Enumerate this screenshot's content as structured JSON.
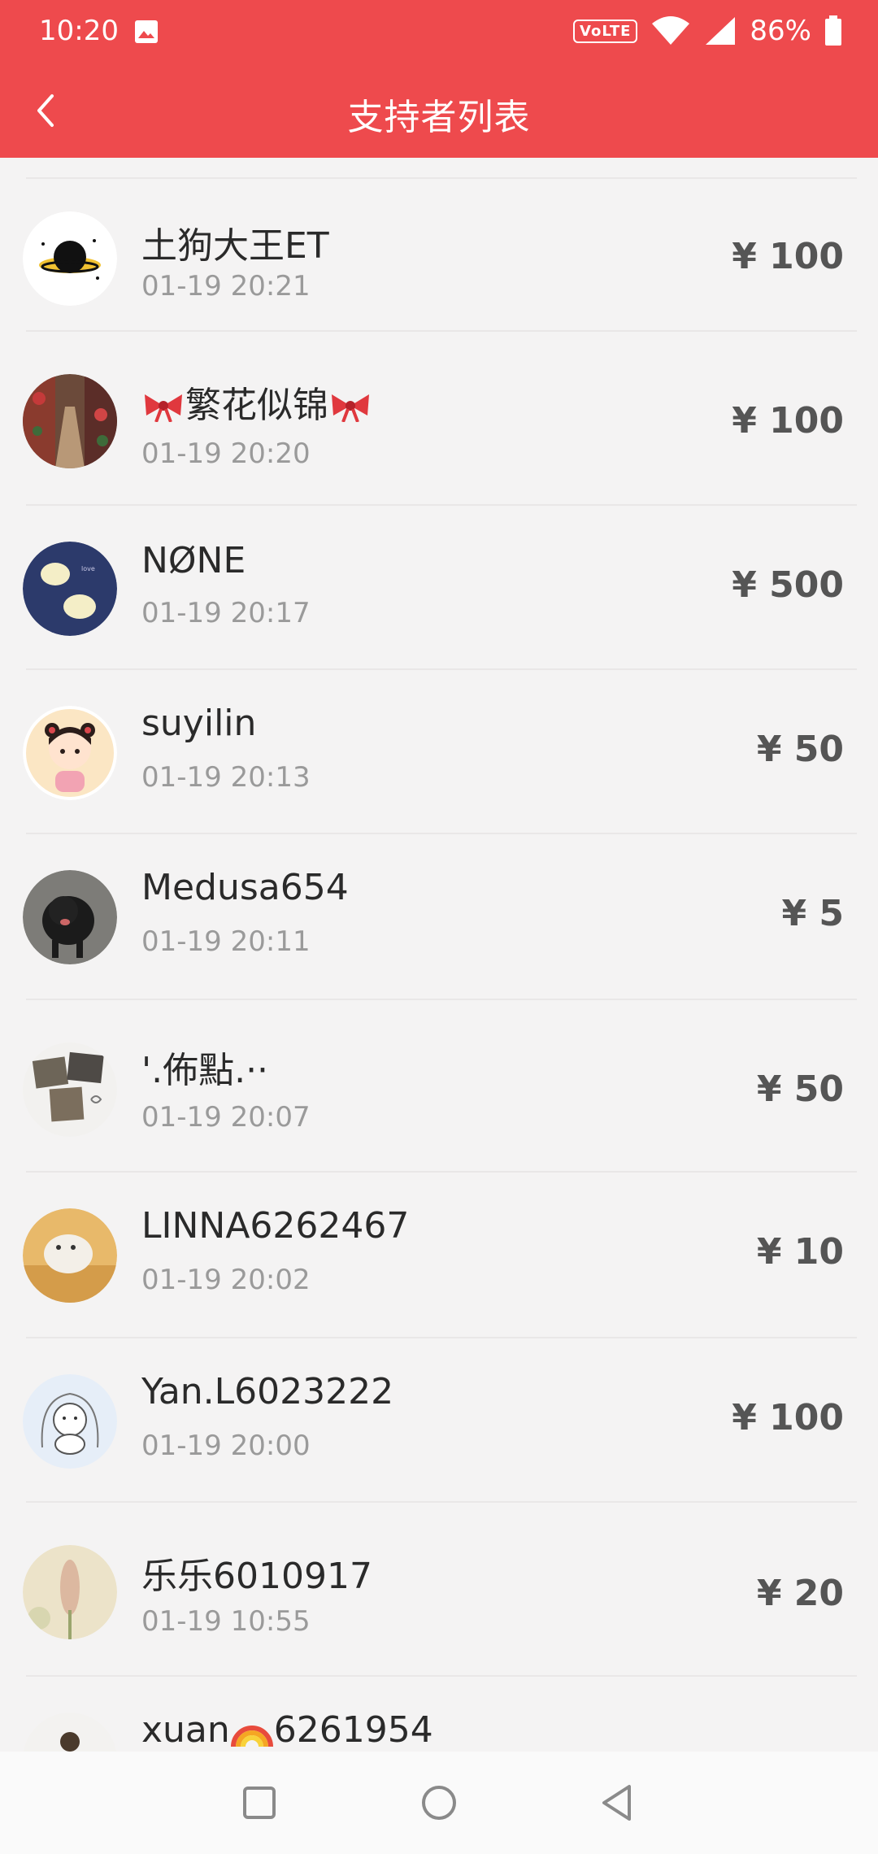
{
  "status_bar": {
    "time": "10:20",
    "network_badge": "VoLTE",
    "battery": "86%",
    "icons": [
      "image-icon",
      "wifi-icon",
      "signal-icon",
      "battery-icon"
    ]
  },
  "header": {
    "title": "支持者列表",
    "back_icon": "chevron-left-icon",
    "background_color": "#ee4a4d"
  },
  "supporters": [
    {
      "name": "土狗大王ET",
      "time": "01-19 20:21",
      "amount": "¥ 100"
    },
    {
      "name_mid": "繁花似锦",
      "name_decoration": "ribbon-bow-emoji",
      "time": "01-19 20:20",
      "amount": "¥ 100"
    },
    {
      "name": "NØNE",
      "time": "01-19 20:17",
      "amount": "¥ 500"
    },
    {
      "name": "suyilin",
      "time": "01-19 20:13",
      "amount": "¥ 50"
    },
    {
      "name": "Medusa654",
      "time": "01-19 20:11",
      "amount": "¥ 5"
    },
    {
      "name": "'.佈點.··",
      "time": "01-19 20:07",
      "amount": "¥ 50"
    },
    {
      "name": "LINNA6262467",
      "time": "01-19 20:02",
      "amount": "¥ 10"
    },
    {
      "name": "Yan.L6023222",
      "time": "01-19 20:00",
      "amount": "¥ 100"
    },
    {
      "name": "乐乐6010917",
      "time": "01-19 10:55",
      "amount": "¥ 20"
    },
    {
      "name": "xuan",
      "name_tail": "6261954",
      "time": "",
      "amount": ""
    }
  ],
  "nav_bar": {
    "icons": [
      "recents-square-icon",
      "home-circle-icon",
      "back-triangle-icon"
    ]
  }
}
